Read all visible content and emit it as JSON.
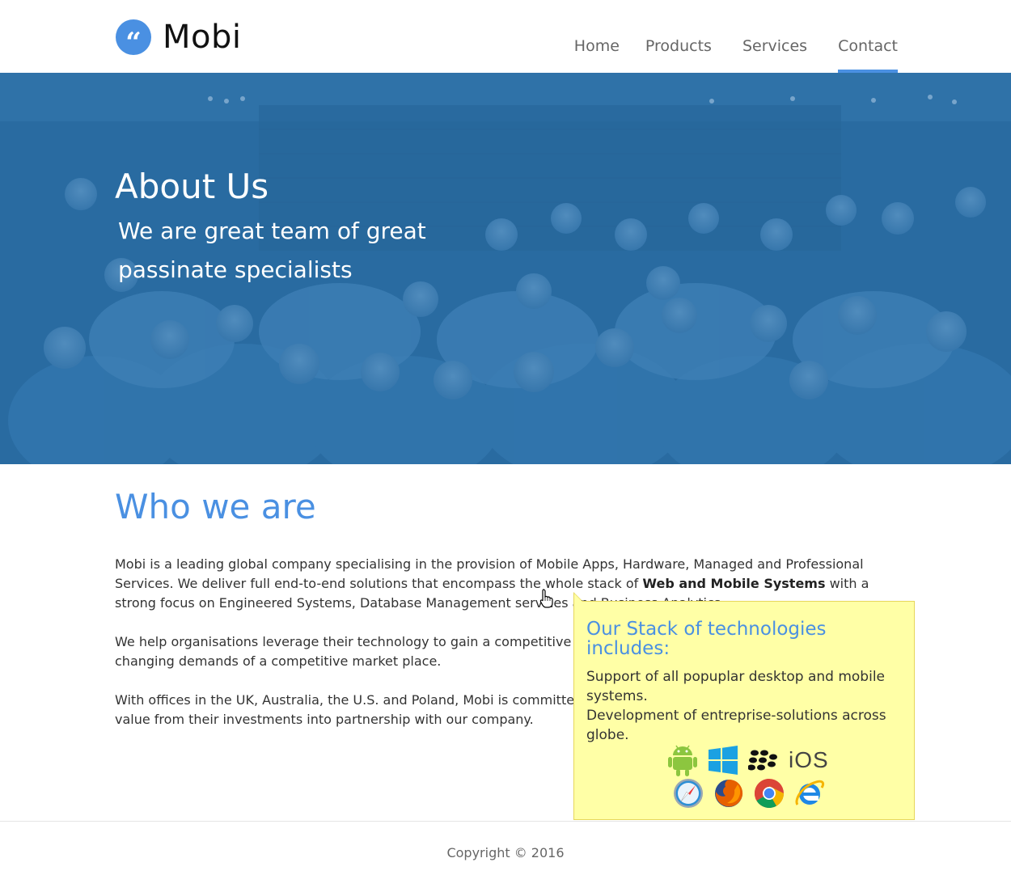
{
  "brand": {
    "name": "Mobi",
    "logo_icon": "quote-icon",
    "accent": "#4a90e2"
  },
  "nav": {
    "items": [
      {
        "label": "Home"
      },
      {
        "label": "Products"
      },
      {
        "label": "Services"
      },
      {
        "label": "Contact",
        "active": true
      }
    ]
  },
  "hero": {
    "title": "About Us",
    "subtitle": "We are great team of great passinate specialists"
  },
  "about": {
    "title": "Who we are",
    "p1_a": "Mobi is a leading global company specialising in the provision of Mobile Apps, Hardware, Managed and Professional Services. We deliver full end-to-end solutions that encompass the whole stack of ",
    "p1_bold": "Web and Mobile Systems",
    "p1_b": " with a strong focus on Engineered Systems, Database Management services and Business Analytics.",
    "p2": "We help organisations leverage their technology to gain a competitive advantage and keep pace with the continuously changing demands of a competitive market place.",
    "p3": "With offices in the UK, Australia, the U.S. and Poland, Mobi is committed to ensuring that its customers get the most value from their investments into partnership with our company."
  },
  "tooltip": {
    "title": "Our Stack of technologies includes:",
    "line1": "Support of all popuplar desktop and mobile systems.",
    "line2": "Development of entreprise-solutions across globe.",
    "os_icons": [
      "android-icon",
      "windows-icon",
      "blackberry-icon",
      "ios-icon"
    ],
    "browser_icons": [
      "safari-icon",
      "firefox-icon",
      "chrome-icon",
      "internet-explorer-icon"
    ],
    "ios_label": "iOS"
  },
  "footer": {
    "copyright": "Copyright © 2016"
  }
}
